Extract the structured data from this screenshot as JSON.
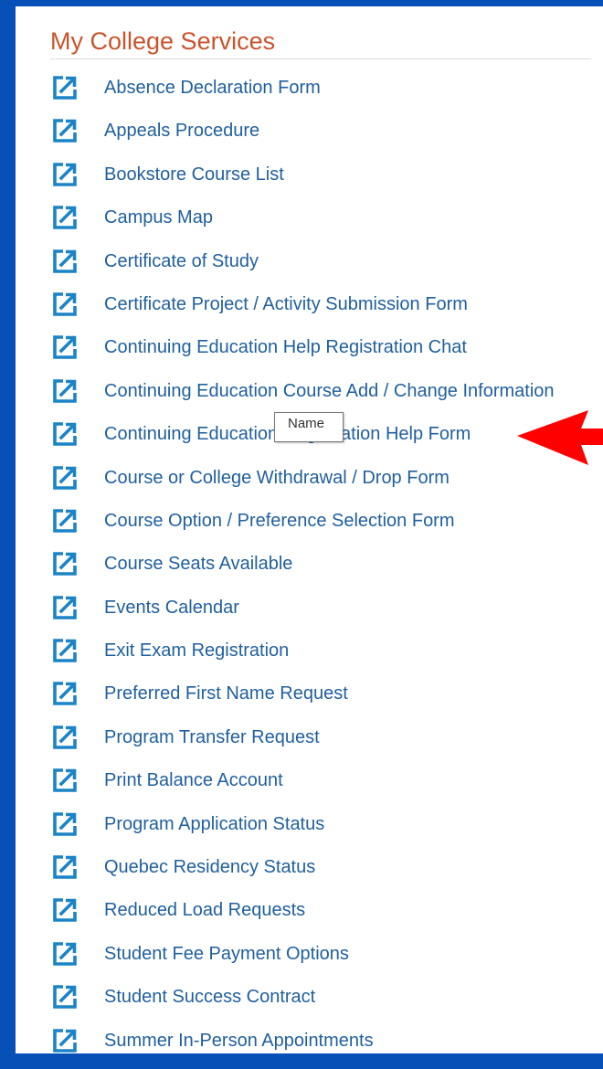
{
  "section": {
    "title": "My College Services"
  },
  "colors": {
    "background": "#0650b8",
    "heading": "#c8542c",
    "link": "#1f5f9e",
    "icon": "#1b84c6",
    "arrow": "#ff0000"
  },
  "icon_name": "external-link-icon",
  "services": [
    {
      "label": "Absence Declaration Form"
    },
    {
      "label": "Appeals Procedure"
    },
    {
      "label": "Bookstore Course List"
    },
    {
      "label": "Campus Map"
    },
    {
      "label": "Certificate of Study"
    },
    {
      "label": "Certificate Project / Activity Submission Form"
    },
    {
      "label": "Continuing Education Help Registration Chat"
    },
    {
      "label": "Continuing Education Course Add / Change Information"
    },
    {
      "label": "Continuing Education Registration Help Form"
    },
    {
      "label": "Course or College Withdrawal / Drop Form"
    },
    {
      "label": "Course Option / Preference Selection Form"
    },
    {
      "label": "Course Seats Available"
    },
    {
      "label": "Events Calendar"
    },
    {
      "label": "Exit Exam Registration"
    },
    {
      "label": "Preferred First Name Request"
    },
    {
      "label": "Program Transfer Request"
    },
    {
      "label": "Print Balance Account"
    },
    {
      "label": "Program Application Status"
    },
    {
      "label": "Quebec Residency Status"
    },
    {
      "label": "Reduced Load Requests"
    },
    {
      "label": "Student Fee Payment Options"
    },
    {
      "label": "Student Success Contract"
    },
    {
      "label": "Summer In-Person Appointments"
    }
  ],
  "tooltip": {
    "text": "Name"
  }
}
